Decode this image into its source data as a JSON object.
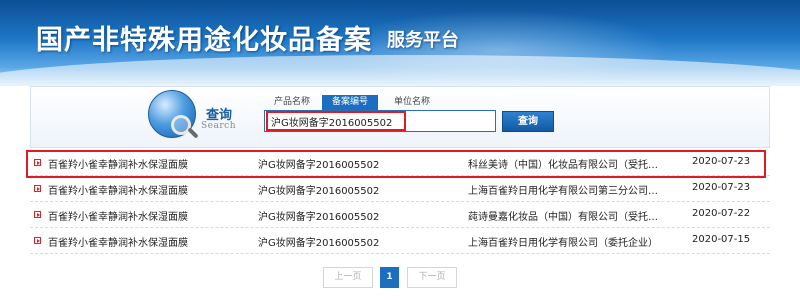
{
  "header": {
    "title": "国产非特殊用途化妆品备案",
    "subtitle": "服务平台"
  },
  "search": {
    "label": "查询",
    "label_en": "Search",
    "tabs": [
      {
        "label": "产品名称",
        "active": false
      },
      {
        "label": "备案编号",
        "active": true
      },
      {
        "label": "单位名称",
        "active": false
      }
    ],
    "input_value": "沪G妆网备字2016005502",
    "button_label": "查询"
  },
  "results": [
    {
      "name": "百雀羚小雀幸静润补水保湿面膜",
      "code": "沪G妆网备字2016005502",
      "company": "科丝美诗（中国）化妆品有限公司（受托…",
      "date": "2020-07-23",
      "highlighted": true
    },
    {
      "name": "百雀羚小雀幸静润补水保湿面膜",
      "code": "沪G妆网备字2016005502",
      "company": "上海百雀羚日用化学有限公司第三分公司…",
      "date": "2020-07-23",
      "highlighted": false
    },
    {
      "name": "百雀羚小雀幸静润补水保湿面膜",
      "code": "沪G妆网备字2016005502",
      "company": "莼诗曼嘉化妆品（中国）有限公司（受托…",
      "date": "2020-07-22",
      "highlighted": false
    },
    {
      "name": "百雀羚小雀幸静润补水保湿面膜",
      "code": "沪G妆网备字2016005502",
      "company": "上海百雀羚日用化学有限公司（委托企业）",
      "date": "2020-07-15",
      "highlighted": false
    }
  ],
  "pagination": {
    "prev_label": "上一页",
    "current_page": "1",
    "next_label": "下一页"
  },
  "colors": {
    "accent": "#1c6fc0",
    "highlight": "#e01b24",
    "bullet": "#d22a2a"
  }
}
